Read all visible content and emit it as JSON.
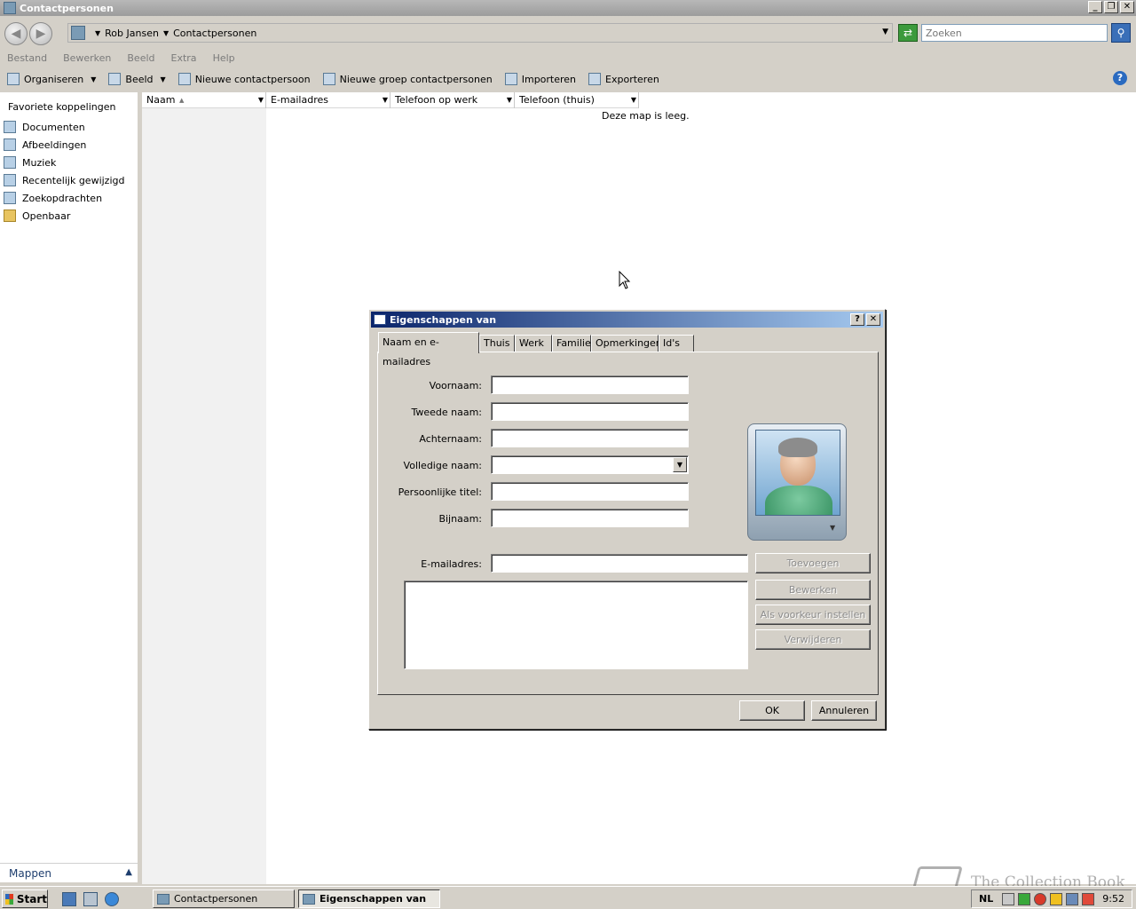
{
  "window": {
    "title": "Contactpersonen",
    "controls": {
      "minimize": "_",
      "restore": "❐",
      "close": "✕"
    }
  },
  "address": {
    "breadcrumb": [
      "Rob Jansen",
      "Contactpersonen"
    ],
    "search_placeholder": "Zoeken"
  },
  "menu": [
    "Bestand",
    "Bewerken",
    "Beeld",
    "Extra",
    "Help"
  ],
  "toolbar": {
    "organize": "Organiseren",
    "view": "Beeld",
    "new_contact": "Nieuwe contactpersoon",
    "new_group": "Nieuwe groep contactpersonen",
    "import": "Importeren",
    "export": "Exporteren"
  },
  "nav": {
    "header": "Favoriete koppelingen",
    "items": [
      {
        "label": "Documenten",
        "icon": "documents-icon"
      },
      {
        "label": "Afbeeldingen",
        "icon": "pictures-icon"
      },
      {
        "label": "Muziek",
        "icon": "music-icon"
      },
      {
        "label": "Recentelijk gewijzigd",
        "icon": "recent-icon"
      },
      {
        "label": "Zoekopdrachten",
        "icon": "searches-icon"
      },
      {
        "label": "Openbaar",
        "icon": "folder-icon"
      }
    ],
    "folders_label": "Mappen"
  },
  "list": {
    "columns": [
      "Naam",
      "E-mailadres",
      "Telefoon op werk",
      "Telefoon (thuis)"
    ],
    "empty_message": "Deze map is leeg."
  },
  "dialog": {
    "title": "Eigenschappen van",
    "controls": {
      "help": "?",
      "close": "✕"
    },
    "tabs": [
      "Naam en e-mailadres",
      "Thuis",
      "Werk",
      "Familie",
      "Opmerkingen",
      "Id's"
    ],
    "active_tab": 0,
    "fields": {
      "first_name": "Voornaam:",
      "middle_name": "Tweede naam:",
      "last_name": "Achternaam:",
      "full_name": "Volledige naam:",
      "personal_title": "Persoonlijke titel:",
      "nickname": "Bijnaam:",
      "email": "E-mailadres:"
    },
    "email_buttons": {
      "add": "Toevoegen",
      "edit": "Bewerken",
      "set_preferred": "Als voorkeur instellen",
      "remove": "Verwijderen"
    },
    "ok": "OK",
    "cancel": "Annuleren"
  },
  "taskbar": {
    "start": "Start",
    "tasks": [
      "Contactpersonen",
      "Eigenschappen van"
    ],
    "active_task": 1,
    "language": "NL",
    "clock": "9:52"
  },
  "watermark": "The Collection Book"
}
